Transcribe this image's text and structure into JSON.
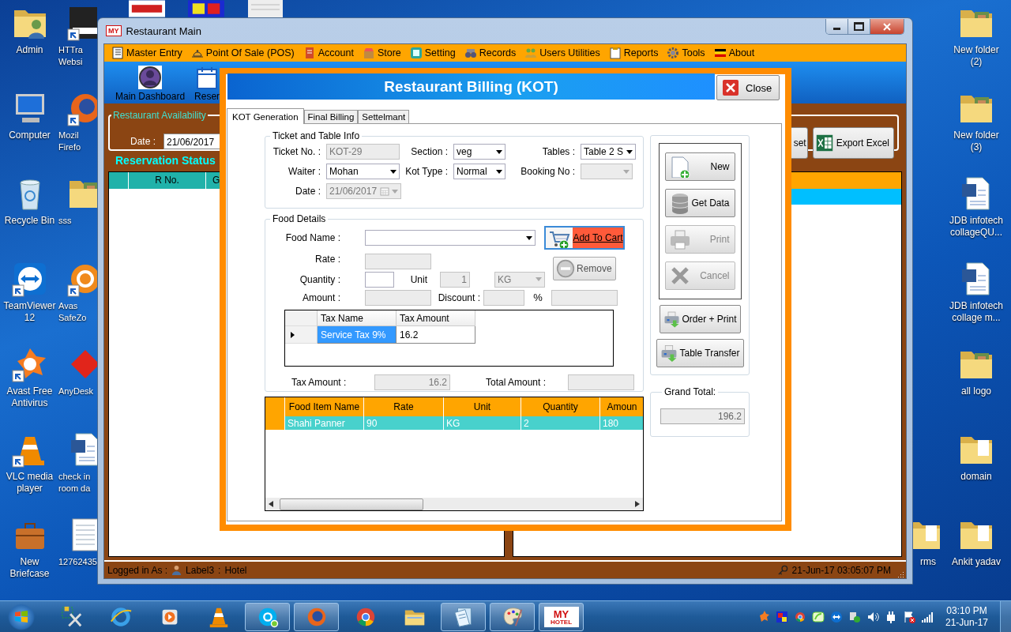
{
  "desktop_left": [
    {
      "label_lines": [
        "Admin"
      ],
      "shortcut": false
    },
    {
      "label_lines": [
        "Computer"
      ],
      "shortcut": false
    },
    {
      "label_lines": [
        "Recycle Bin"
      ],
      "shortcut": false
    },
    {
      "label_lines": [
        "TeamViewer",
        "12"
      ],
      "shortcut": true
    },
    {
      "label_lines": [
        "Avast Free",
        "Antivirus"
      ],
      "shortcut": true
    },
    {
      "label_lines": [
        "VLC media",
        "player"
      ],
      "shortcut": true
    },
    {
      "label_lines": [
        "New",
        "Briefcase"
      ],
      "shortcut": false
    }
  ],
  "desktop_second": [
    {
      "label_lines": [
        "HTTra",
        "Websi"
      ],
      "shortcut": true
    },
    {
      "label_lines": [
        "Mozil",
        "Firefo"
      ],
      "shortcut": true
    },
    {
      "label_lines": [
        "sss"
      ],
      "shortcut": false
    },
    {
      "label_lines": [
        "Avas",
        "SafeZo"
      ],
      "shortcut": true
    },
    {
      "label_lines": [
        "AnyDesk"
      ],
      "shortcut": false
    },
    {
      "label_lines": [
        "check in",
        "room da"
      ],
      "shortcut": false
    },
    {
      "label_lines": [
        "12762435"
      ],
      "shortcut": false
    }
  ],
  "desktop_right": [
    {
      "label_lines": [
        "New folder",
        "(2)"
      ],
      "shortcut": false
    },
    {
      "label_lines": [
        "New folder",
        "(3)"
      ],
      "shortcut": false
    },
    {
      "label_lines": [
        "JDB infotech",
        "collageQU..."
      ],
      "shortcut": false
    },
    {
      "label_lines": [
        "JDB infotech",
        "collage m..."
      ],
      "shortcut": false
    },
    {
      "label_lines": [
        "all logo"
      ],
      "shortcut": false
    },
    {
      "label_lines": [
        "domain"
      ],
      "shortcut": false
    },
    {
      "label_lines": [
        "Ankit yadav"
      ],
      "shortcut": false
    }
  ],
  "desktop_partial": {
    "label": "rms"
  },
  "main_window": {
    "logo": "MY",
    "title": "Restaurant Main",
    "menu": [
      {
        "label": "Master Entry"
      },
      {
        "label": "Point Of Sale (POS)"
      },
      {
        "label": "Account"
      },
      {
        "label": "Store"
      },
      {
        "label": "Setting"
      },
      {
        "label": "Records"
      },
      {
        "label": "Users Utilities"
      },
      {
        "label": "Reports"
      },
      {
        "label": "Tools"
      },
      {
        "label": "About"
      }
    ],
    "toolbar": [
      {
        "label": "Main Dashboard"
      },
      {
        "label": "Reser"
      }
    ],
    "availability": {
      "legend": "Restaurant Availability",
      "date_label": "Date :",
      "date": "21/06/2017",
      "buttons": [
        {
          "label": "set"
        },
        {
          "label": "Export Excel"
        }
      ]
    },
    "reservation_heading": "Reservation Status",
    "left_table": {
      "columns": [
        "R No.",
        "G"
      ]
    },
    "right_table": {
      "rows": [
        {
          "selected": true
        }
      ]
    },
    "status_bar": {
      "user_label": "Logged in As :",
      "user": "Label3",
      "separator": ":",
      "role": "Hotel",
      "datetime": "21-Jun-17 03:05:07 PM"
    }
  },
  "dialog": {
    "title": "Restaurant Billing (KOT)",
    "close": "Close",
    "tabs": [
      {
        "label": "KOT Generation",
        "selected": true
      },
      {
        "label": "Final Billing",
        "selected": false
      },
      {
        "label": "Settelmant",
        "selected": false
      }
    ],
    "ticket": {
      "legend": "Ticket and Table Info",
      "ticket_no": {
        "label": "Ticket No. :",
        "value": "KOT-29",
        "disabled": true
      },
      "section": {
        "label": "Section :",
        "value": "veg",
        "disabled": false
      },
      "tables": {
        "label": "Tables :",
        "value": "Table 2 S",
        "disabled": false
      },
      "waiter": {
        "label": "Waiter :",
        "value": "Mohan",
        "disabled": false
      },
      "kot_type": {
        "label": "Kot Type :",
        "value": "Normal",
        "disabled": false
      },
      "booking_no": {
        "label": "Booking No :",
        "disabled": true
      },
      "date": {
        "label": "Date :",
        "value": "21/06/2017",
        "disabled": true
      }
    },
    "food": {
      "legend": "Food Details",
      "food_name": {
        "label": "Food Name :",
        "disabled": false
      },
      "rate": {
        "label": "Rate :",
        "disabled": true
      },
      "quantity": {
        "label": "Quantity :",
        "disabled": false
      },
      "unit": {
        "label": "Unit",
        "value": "1",
        "disabled": true
      },
      "unit_type": {
        "value": "KG",
        "disabled": true
      },
      "amount": {
        "label": "Amount :",
        "disabled": true
      },
      "discount": {
        "label": "Discount :",
        "disabled": true
      },
      "discount_value": {
        "label": "%",
        "disabled": true
      },
      "add_button": "Add To Cart",
      "remove_button": "Remove",
      "taxes": {
        "columns": [
          "Tax Name",
          "Tax Amount"
        ],
        "rows": [
          {
            "cells": [
              "Service Tax 9%",
              "16.2"
            ],
            "selected": true
          }
        ]
      },
      "tax_amount": {
        "label": "Tax Amount :",
        "value": "16.2",
        "disabled": true
      },
      "total_amount": {
        "label": "Total Amount :",
        "disabled": true
      }
    },
    "items": {
      "columns": [
        "Food Item Name",
        "Rate",
        "Unit",
        "Quantity",
        "Amoun"
      ],
      "rows": [
        {
          "cells": [
            "Shahi Panner",
            "90",
            "KG",
            "2",
            "180"
          ],
          "selected": true
        }
      ]
    },
    "actions": [
      {
        "label": "New",
        "disabled": false
      },
      {
        "label": "Get Data",
        "disabled": false
      },
      {
        "label": "Print",
        "disabled": true
      },
      {
        "label": "Cancel",
        "disabled": true
      }
    ],
    "actions2": [
      {
        "label": "Order + Print",
        "disabled": false
      },
      {
        "label": "Table Transfer",
        "disabled": false
      }
    ],
    "grand_total": {
      "label": "Grand Total:",
      "value": "196.2"
    }
  },
  "taskbar": {
    "items": [
      {
        "open": false
      },
      {
        "open": false
      },
      {
        "open": false
      },
      {
        "open": false
      },
      {
        "open": true
      },
      {
        "open": true
      },
      {
        "open": false
      },
      {
        "open": false
      },
      {
        "open": true
      },
      {
        "open": true
      },
      {
        "open": true
      }
    ],
    "logo": "MY",
    "logo_caption": "HOTEL",
    "time": "03:10 PM",
    "date": "21-Jun-17"
  }
}
